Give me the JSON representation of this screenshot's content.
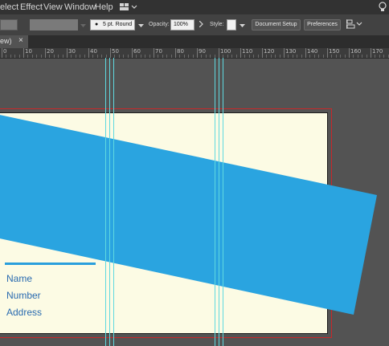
{
  "menubar": {
    "items": [
      "elect",
      "Effect",
      "View",
      "Window",
      "Help"
    ]
  },
  "control": {
    "stroke_profile": "5 pt. Round",
    "opacity_label": "Opacity:",
    "opacity_value": "100%",
    "style_label": "Style:",
    "document_setup": "Document Setup",
    "preferences": "Preferences"
  },
  "tab": {
    "title": "ew)",
    "close": "×"
  },
  "ruler": {
    "labels": [
      "0",
      "10",
      "20",
      "30",
      "40",
      "50",
      "60",
      "70",
      "80",
      "90",
      "100",
      "110",
      "120",
      "130",
      "140",
      "150",
      "160",
      "170"
    ]
  },
  "card": {
    "fields": [
      "Name",
      "Number",
      "Address"
    ]
  },
  "colors": {
    "accent_blue": "#2aa4e0",
    "artboard": "#fcfbe4",
    "bleed": "#c8282a",
    "guide": "#5fd9e0"
  },
  "icons": [
    "workspace-switcher-icon",
    "lightbulb-icon",
    "align-icon",
    "close-icon",
    "chevron-down-icon"
  ]
}
